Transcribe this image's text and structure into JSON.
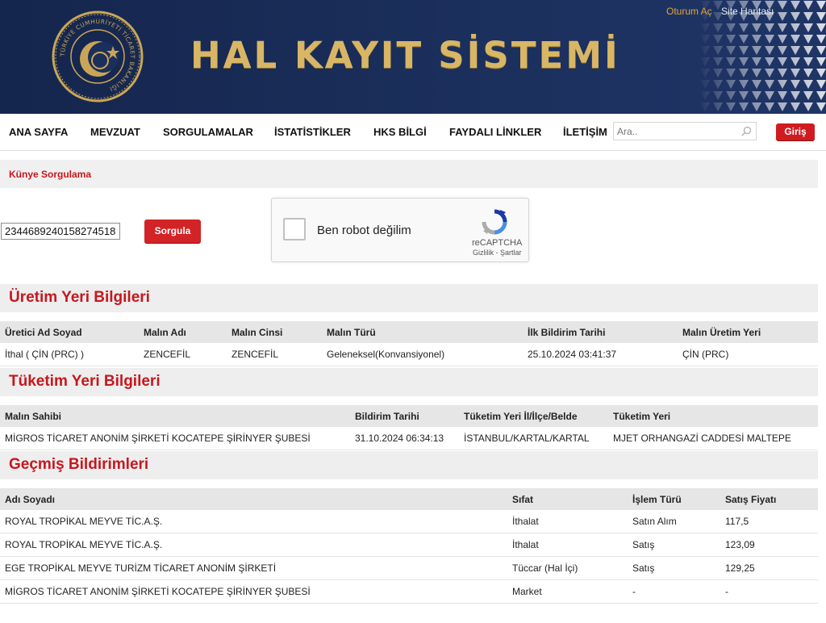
{
  "header": {
    "logo_text_1": "HAL KAYIT",
    "logo_text_2": "SİSTEMİ",
    "login_link": "Oturum Aç",
    "sitemap_link": "Site Haritası",
    "seal_text": "TÜRKİYE CUMHURİYETİ TİCARET BAKANLIĞI"
  },
  "nav": {
    "items": [
      "ANA SAYFA",
      "MEVZUAT",
      "SORGULAMALAR",
      "İSTATİSTİKLER",
      "HKS BİLGİ",
      "FAYDALI LİNKLER",
      "İLETİŞİM"
    ],
    "search_placeholder": "Ara..",
    "login_button": "Giriş"
  },
  "query": {
    "title": "Künye Sorgulama",
    "input_value": "2344689240158274518",
    "button": "Sorgula"
  },
  "captcha": {
    "label": "Ben robot değilim",
    "brand": "reCAPTCHA",
    "privacy": "Gizlilik",
    "separator": "-",
    "terms": "Şartlar"
  },
  "production": {
    "title": "Üretim Yeri Bilgileri",
    "headers": [
      "Üretici Ad Soyad",
      "Malın Adı",
      "Malın Cinsi",
      "Malın Türü",
      "İlk Bildirim Tarihi",
      "Malın Üretim Yeri"
    ],
    "rows": [
      [
        "İthal ( ÇİN (PRC) )",
        "ZENCEFİL",
        "ZENCEFİL",
        "Geleneksel(Konvansiyonel)",
        "25.10.2024 03:41:37",
        "ÇİN (PRC)"
      ]
    ]
  },
  "consumption": {
    "title": "Tüketim Yeri Bilgileri",
    "headers": [
      "Malın Sahibi",
      "Bildirim Tarihi",
      "Tüketim Yeri İl/İlçe/Belde",
      "Tüketim Yeri"
    ],
    "rows": [
      [
        "MİGROS TİCARET ANONİM ŞİRKETİ KOCATEPE ŞİRİNYER ŞUBESİ",
        "31.10.2024 06:34:13",
        "İSTANBUL/KARTAL/KARTAL",
        "MJET ORHANGAZİ CADDESİ MALTEPE"
      ]
    ]
  },
  "history": {
    "title": "Geçmiş Bildirimleri",
    "headers": [
      "Adı Soyadı",
      "Sıfat",
      "İşlem Türü",
      "Satış Fiyatı"
    ],
    "rows": [
      [
        "ROYAL TROPİKAL MEYVE TİC.A.Ş.",
        "İthalat",
        "Satın Alım",
        "117,5"
      ],
      [
        "ROYAL TROPİKAL MEYVE TİC.A.Ş.",
        "İthalat",
        "Satış",
        "123,09"
      ],
      [
        "EGE TROPİKAL MEYVE TURİZM TİCARET ANONİM ŞİRKETİ",
        "Tüccar (Hal İçi)",
        "Satış",
        "129,25"
      ],
      [
        "MİGROS TİCARET ANONİM ŞİRKETİ KOCATEPE ŞİRİNYER ŞUBESİ",
        "Market",
        "-",
        "-"
      ]
    ]
  },
  "colors": {
    "header_bg": "#1b2f5c",
    "gold": "#d8b665",
    "accent_red": "#c8161d",
    "button_red": "#d22326"
  }
}
